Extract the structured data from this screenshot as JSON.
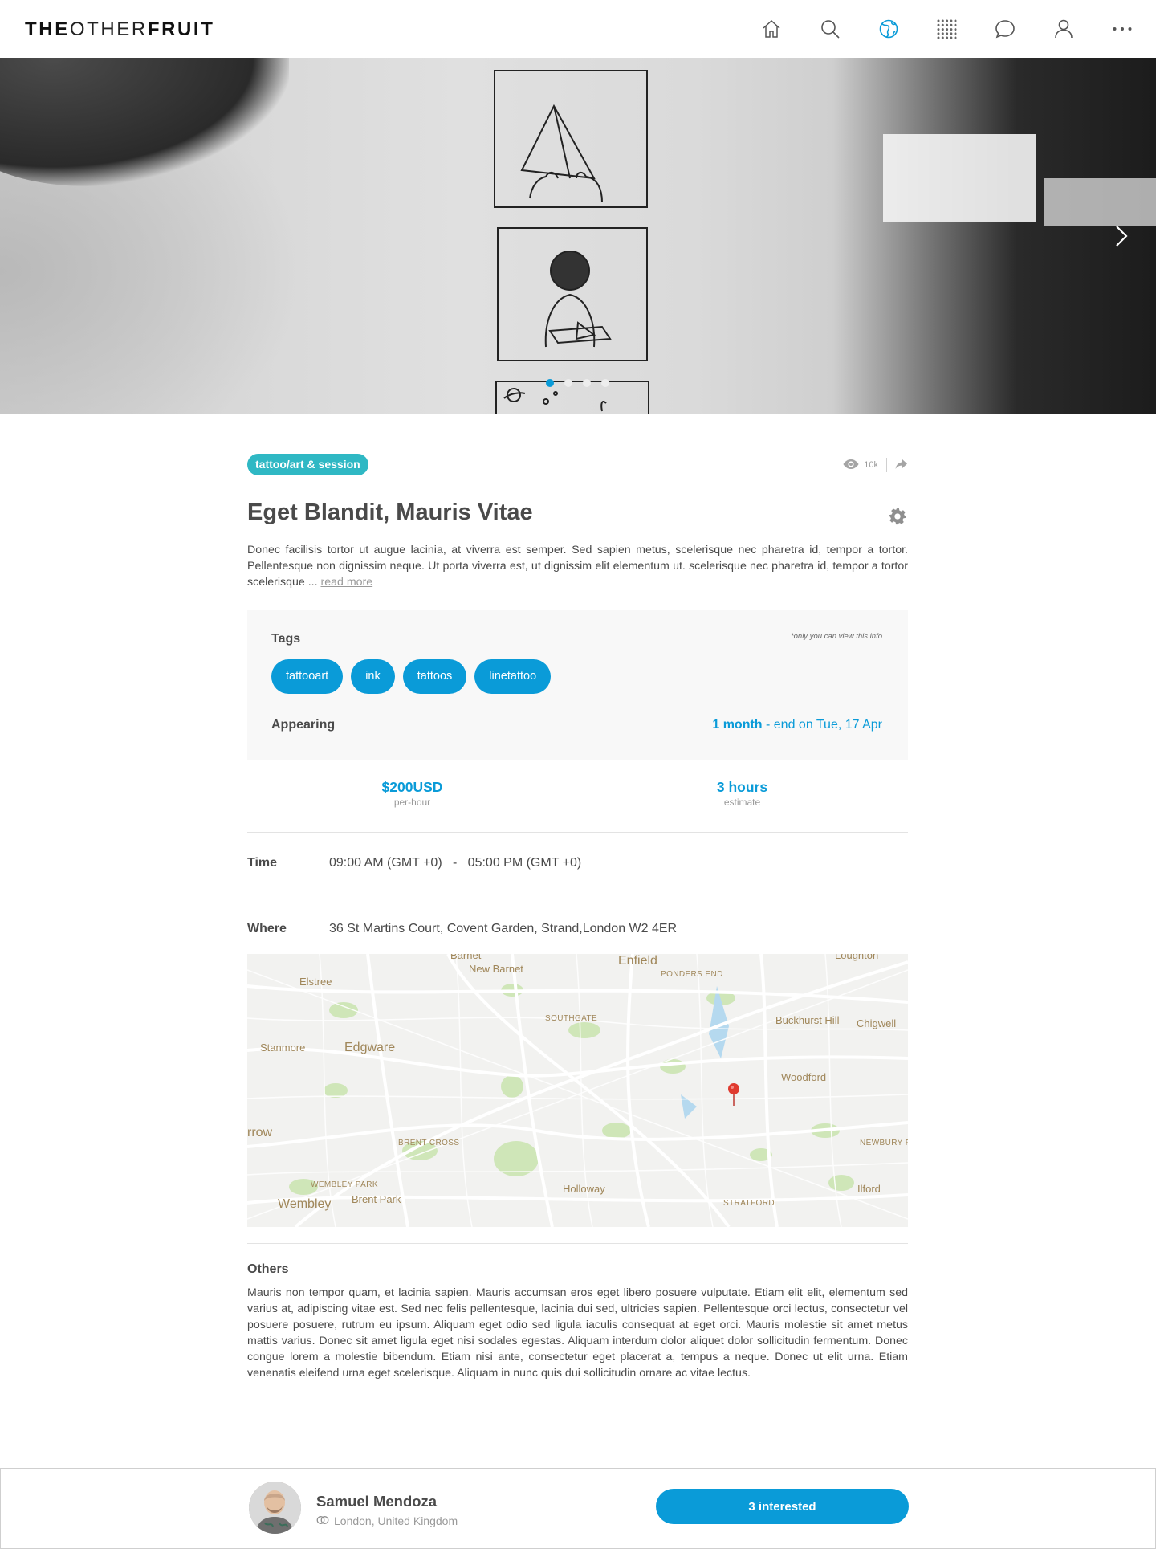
{
  "brand": {
    "part1": "THE",
    "part2": "OTHER",
    "part3": "FRUIT"
  },
  "nav": {
    "icons": [
      "home-icon",
      "search-icon",
      "globe-icon",
      "grid-icon",
      "chat-icon",
      "user-icon",
      "more-icon"
    ],
    "active": "globe-icon",
    "accent": "#0a9bd8"
  },
  "gallery": {
    "slide_count": 4,
    "active_index": 0
  },
  "listing": {
    "category": "tattoo/art & session",
    "views": "10k",
    "title": "Eget Blandit, Mauris Vitae",
    "description": "Donec facilisis tortor ut augue lacinia, at viverra est semper. Sed sapien metus, scelerisque nec pharetra id, tempor a tortor. Pellentesque non dignissim neque. Ut porta viverra est, ut dignissim elit elementum ut.  scelerisque nec pharetra id, tempor a tortor  scelerisque ... ",
    "read_more": "read more"
  },
  "info": {
    "tags_label": "Tags",
    "private_note": "*only you can view this info",
    "tags": [
      "tattooart",
      "ink",
      "tattoos",
      "linetattoo"
    ],
    "appearing_label": "Appearing",
    "appearing_duration": "1 month",
    "appearing_end": " - end on Tue, 17 Apr"
  },
  "pricing": {
    "price": "$200USD",
    "price_sub": "per-hour",
    "duration": "3 hours",
    "duration_sub": "estimate"
  },
  "time": {
    "label": "Time",
    "start": "09:00 AM (GMT +0)",
    "separator": "-",
    "end": "05:00 PM (GMT +0)"
  },
  "where": {
    "label": "Where",
    "address": "36 St Martins Court, Covent Garden, Strand,London W2 4ER"
  },
  "map": {
    "places": {
      "barnet": "Barnet",
      "enfield": "Enfield",
      "loughton": "Loughton",
      "new_barnet": "New Barnet",
      "elstree": "Elstree",
      "ponders_end": "PONDERS END",
      "southgate": "SOUTHGATE",
      "buckhurst_hill": "Buckhurst Hill",
      "chigwell": "Chigwell",
      "stanmore": "Stanmore",
      "edgware": "Edgware",
      "woodford": "Woodford",
      "harrow": "rrow",
      "brent_cross": "BRENT CROSS",
      "newbury": "NEWBURY P",
      "wembley_park": "WEMBLEY PARK",
      "holloway": "Holloway",
      "ilford": "Ilford",
      "wembley": "Wembley",
      "brent_park": "Brent Park",
      "stratford": "STRATFORD"
    },
    "pin_color": "#e03a2f"
  },
  "others": {
    "label": "Others",
    "text": "Mauris non tempor quam, et lacinia sapien. Mauris accumsan eros eget libero posuere vulputate. Etiam elit elit, elementum sed varius at, adipiscing vitae est. Sed nec felis pellentesque, lacinia dui sed, ultricies sapien. Pellentesque orci lectus, consectetur vel posuere posuere, rutrum eu ipsum. Aliquam eget odio sed ligula iaculis consequat at eget orci. Mauris molestie sit amet metus mattis varius. Donec sit amet ligula eget nisi sodales egestas. Aliquam interdum dolor aliquet dolor sollicitudin fermentum. Donec congue lorem a molestie bibendum. Etiam nisi ante, consectetur eget placerat a, tempus a neque. Donec ut elit urna. Etiam venenatis eleifend urna eget scelerisque. Aliquam in nunc quis dui sollicitudin ornare ac vitae lectus."
  },
  "owner": {
    "name": "Samuel Mendoza",
    "location": "London, United Kingdom",
    "interested_label": "3 interested"
  }
}
